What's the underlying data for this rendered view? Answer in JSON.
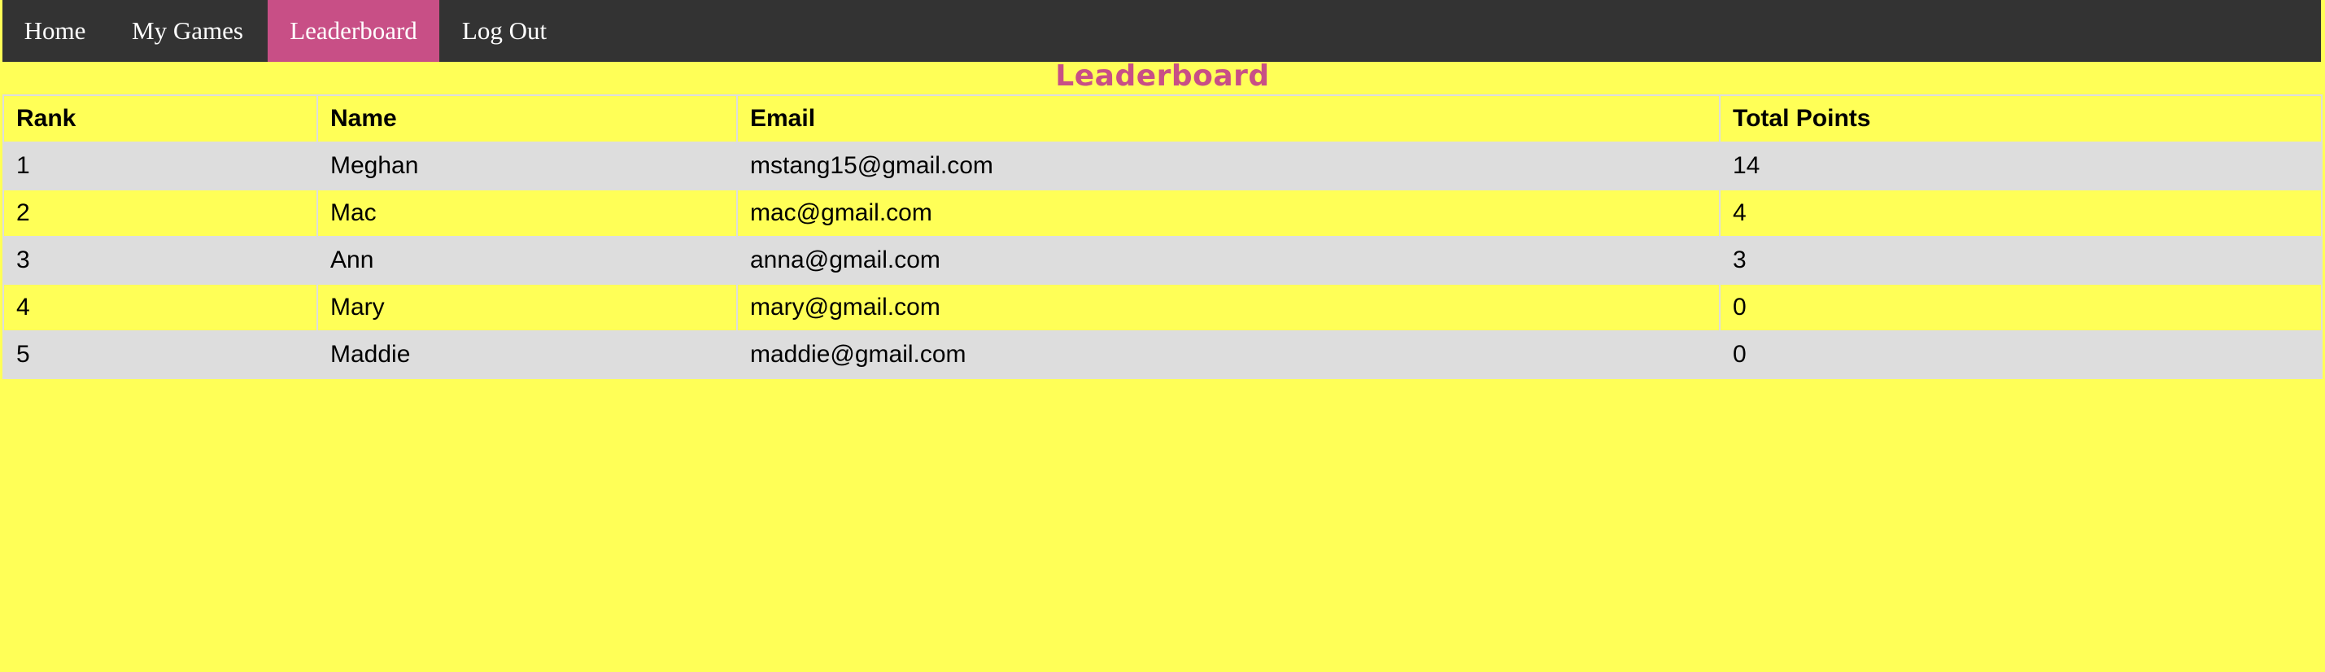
{
  "nav": {
    "items": [
      {
        "label": "Home",
        "active": false
      },
      {
        "label": "My Games",
        "active": false
      },
      {
        "label": "Leaderboard",
        "active": true
      },
      {
        "label": "Log Out",
        "active": false
      }
    ]
  },
  "page": {
    "title": "Leaderboard"
  },
  "table": {
    "columns": [
      "Rank",
      "Name",
      "Email",
      "Total Points"
    ],
    "rows": [
      [
        "1",
        "Meghan",
        "mstang15@gmail.com",
        "14"
      ],
      [
        "2",
        "Mac",
        "mac@gmail.com",
        "4"
      ],
      [
        "3",
        "Ann",
        "anna@gmail.com",
        "3"
      ],
      [
        "4",
        "Mary",
        "mary@gmail.com",
        "0"
      ],
      [
        "5",
        "Maddie",
        "maddie@gmail.com",
        "0"
      ]
    ]
  },
  "colors": {
    "background": "#ffff57",
    "navbar": "#333333",
    "accent": "#c84f86",
    "row_alt": "#dddddd"
  }
}
